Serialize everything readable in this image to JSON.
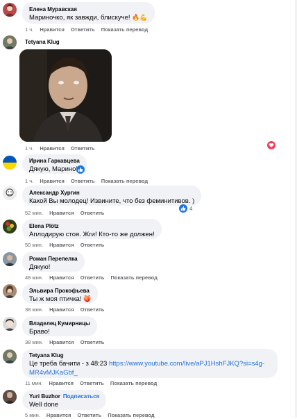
{
  "colors": {
    "bubble_bg": "#f0f2f5",
    "meta_text": "#65676b",
    "link": "#216fdb",
    "like_blue": "#1b74e4",
    "love_red": "#f33e58"
  },
  "comments": [
    {
      "name": "Елена Муравская",
      "text": "Мариночко, як завжди, блискуче!",
      "emoji": "🔥💪",
      "time": "1 ч.",
      "like": "Нравится",
      "reply": "Ответить",
      "translate": "Показать перевод"
    },
    {
      "name": "Tetyana Klug",
      "attachment_icon": "gif-image",
      "time": "1 ч.",
      "like": "Нравится",
      "reply": "Ответить",
      "reaction_icon": "love-reaction-icon"
    },
    {
      "name": "Ирина Гаркавцева",
      "text": "Дякую, Марино!",
      "reaction_icon": "like-reaction-icon",
      "time": "1 ч.",
      "like": "Нравится",
      "reply": "Ответить",
      "translate": "Показать перевод"
    },
    {
      "name": "Александр Хургин",
      "text": "Какой Вы молодец! Извините, что без феминитивов. )",
      "reaction_count": "4",
      "time": "52 мин.",
      "like": "Нравится",
      "reply": "Ответить"
    },
    {
      "name": "Elena Plötz",
      "text": "Аплодирую стоя. Жги! Кто-то же должен!",
      "time": "50 мин.",
      "like": "Нравится",
      "reply": "Ответить"
    },
    {
      "name": "Роман Перепелка",
      "text": "Дякую!",
      "time": "48 мин.",
      "like": "Нравится",
      "reply": "Ответить",
      "translate": "Показать перевод"
    },
    {
      "name": "Эльвира Прокофьева",
      "text": "Ты ж моя птичка!",
      "emoji": "🍑",
      "time": "38 мин.",
      "like": "Нравится",
      "reply": "Ответить"
    },
    {
      "name": "Владелец Кумирницы",
      "text": "Браво!",
      "time": "38 мин.",
      "like": "Нравится",
      "reply": "Ответить"
    },
    {
      "name": "Tetyana Klug",
      "text_line1_prefix": "Це треба бачити - з 48:23 ",
      "text_line1_link": "https://www.youtube.com/live/aPJ1HshFJKQ?si=s4g-",
      "text_line2_link": "MR4vMJKaGbf_",
      "time": "11 мин.",
      "like": "Нравится",
      "reply": "Ответить",
      "translate": "Показать перевод"
    },
    {
      "name": "Yuri Buzhor",
      "follow": "Подписаться",
      "text": "Well done",
      "time": "5 мин.",
      "like": "Нравится",
      "reply": "Ответить",
      "translate": "Показать перевод"
    }
  ]
}
